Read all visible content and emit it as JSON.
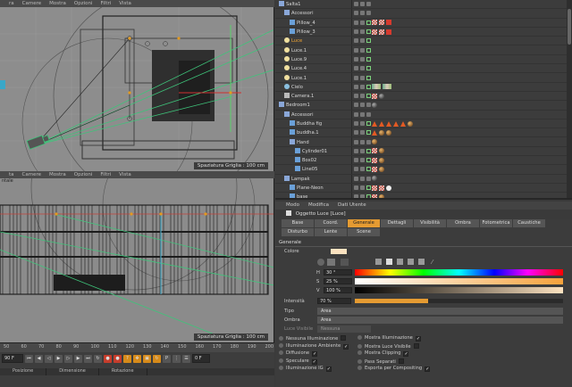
{
  "top_menu": {
    "items": [
      "ra",
      "Camere",
      "Mostra",
      "Opzioni",
      "Filtri",
      "Vista"
    ]
  },
  "top_viewport": {
    "grid_label": "Spaziatura Griglia : 100 cm"
  },
  "mid_menu": {
    "items": [
      "ta",
      "Camere",
      "Mostra",
      "Opzioni",
      "Filtri",
      "Vista"
    ]
  },
  "bottom_viewport": {
    "tag": "ntale",
    "grid_label": "Spaziatura Griglia : 100 cm"
  },
  "timeline": {
    "ruler": [
      "50",
      "60",
      "70",
      "80",
      "90",
      "100",
      "110",
      "120",
      "130",
      "140",
      "150",
      "160",
      "170",
      "180",
      "190",
      "200"
    ],
    "frame_start": "90 F",
    "frame_end": "0 F",
    "panels": [
      "Posizione",
      "Dimensione",
      "Rotazione"
    ]
  },
  "object_manager": {
    "rows": [
      {
        "name": "Salta1",
        "indent": 0,
        "icon": "null",
        "tags": []
      },
      {
        "name": "Accessori",
        "indent": 1,
        "icon": "null",
        "tags": []
      },
      {
        "name": "Pillow_4",
        "indent": 2,
        "icon": "poly",
        "tags": [
          "check",
          "check",
          "red"
        ]
      },
      {
        "name": "Pillow_3",
        "indent": 2,
        "icon": "poly",
        "tags": [
          "check",
          "check",
          "red"
        ]
      },
      {
        "name": "Luce",
        "indent": 1,
        "icon": "light",
        "hl": true,
        "tags": []
      },
      {
        "name": "Luce.1",
        "indent": 1,
        "icon": "light",
        "tags": []
      },
      {
        "name": "Luce.9",
        "indent": 1,
        "icon": "light",
        "tags": []
      },
      {
        "name": "Luce.4",
        "indent": 1,
        "icon": "light",
        "tags": []
      },
      {
        "name": "Luce.1",
        "indent": 1,
        "icon": "light",
        "tags": []
      },
      {
        "name": "Cielo",
        "indent": 1,
        "icon": "sky",
        "tags": [
          "img",
          "img"
        ]
      },
      {
        "name": "Camera.1",
        "indent": 1,
        "icon": "camera",
        "tags": [
          "check",
          "ball"
        ]
      },
      {
        "name": "Bedroom1",
        "indent": 0,
        "icon": "null",
        "tags": [
          "ball"
        ]
      },
      {
        "name": "Accessori",
        "indent": 1,
        "icon": "null",
        "tags": []
      },
      {
        "name": "Buddha fig",
        "indent": 2,
        "icon": "poly",
        "tags": [
          "tri",
          "tri",
          "tri",
          "tri",
          "tri",
          "sph"
        ]
      },
      {
        "name": "buddha.1",
        "indent": 2,
        "icon": "poly",
        "tags": [
          "tri",
          "sph",
          "sph"
        ]
      },
      {
        "name": "Hand",
        "indent": 2,
        "icon": "null",
        "tags": [
          "sph"
        ]
      },
      {
        "name": "Cylinder01",
        "indent": 3,
        "icon": "poly",
        "tags": [
          "check",
          "sph"
        ]
      },
      {
        "name": "Box02",
        "indent": 3,
        "icon": "poly",
        "tags": [
          "check",
          "sph"
        ]
      },
      {
        "name": "Line05",
        "indent": 3,
        "icon": "poly",
        "tags": [
          "check",
          "sph"
        ]
      },
      {
        "name": "Lampak",
        "indent": 1,
        "icon": "null",
        "tags": [
          "ball"
        ]
      },
      {
        "name": "Plane-Neon",
        "indent": 2,
        "icon": "poly",
        "tags": [
          "check",
          "check",
          "wht"
        ]
      },
      {
        "name": "base",
        "indent": 2,
        "icon": "poly",
        "tags": [
          "check",
          "sph"
        ]
      }
    ]
  },
  "attr_manager": {
    "menu": [
      "Modo",
      "Modifica",
      "Dati Utente"
    ],
    "object_title": "Oggetto Luce [Luce]",
    "tabs": [
      {
        "label": "Base",
        "active": false
      },
      {
        "label": "Coord.",
        "active": false
      },
      {
        "label": "Generale",
        "active": true
      },
      {
        "label": "Dettagli",
        "active": false
      },
      {
        "label": "Visibilità",
        "active": false
      },
      {
        "label": "Ombra",
        "active": false
      },
      {
        "label": "Fotometrica",
        "active": false
      },
      {
        "label": "Caustiche",
        "active": false
      },
      {
        "label": "Disturbo",
        "active": false
      },
      {
        "label": "Lente",
        "active": false
      },
      {
        "label": "Scene",
        "active": false
      }
    ],
    "section": "Generale",
    "color_label": "Colore",
    "h_label": "H",
    "h_value": "30 °",
    "s_label": "S",
    "s_value": "25 %",
    "v_label": "V",
    "v_value": "100 %",
    "intensity_label": "Intensità",
    "intensity_value": "70 %",
    "tipo_label": "Tipo",
    "tipo_value": "Area",
    "ombra_label": "Ombra",
    "ombra_value": "Area",
    "luce_visibile_label": "Luce Visibile",
    "luce_visibile_value": "Nessuna",
    "options_left": [
      "Nessuna Illuminazione",
      "Illuminazione Ambiente",
      "Diffusione",
      "Speculare",
      "Illuminazione IG"
    ],
    "options_right": [
      "Mostra Illuminazione",
      "Mostra Luce Visibile",
      "Mostra Clipping",
      "Pass Separati",
      "Esporta per Compositing"
    ]
  },
  "colors": {
    "accent": "#e59b32",
    "light_color": "#fce2c0"
  }
}
